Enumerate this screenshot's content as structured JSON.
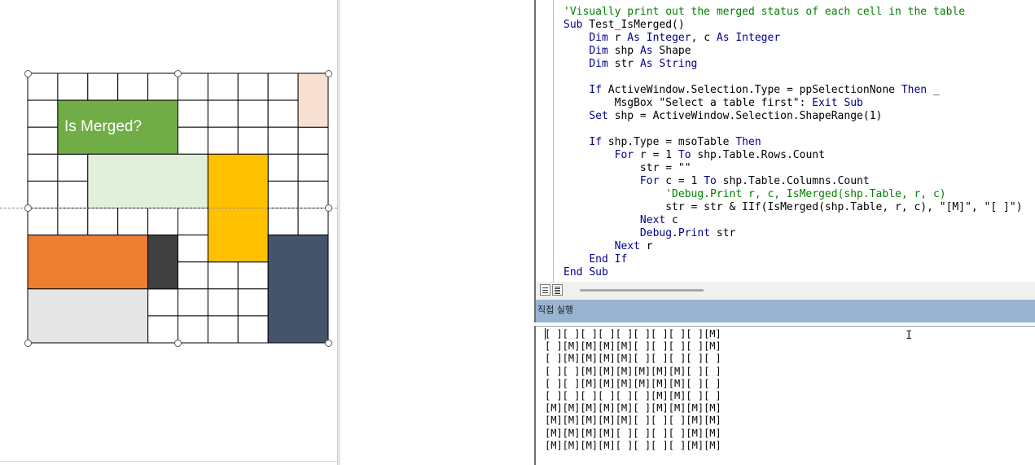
{
  "slide": {
    "table_label": "Is Merged?",
    "colors": {
      "green": "#70ad47",
      "light_green": "#e2efda",
      "peach": "#f8e0d2",
      "yellow": "#ffc000",
      "orange": "#ed7d31",
      "dark_gray": "#404040",
      "navy": "#44546a",
      "light_gray": "#e6e6e6"
    }
  },
  "code": {
    "lines": [
      "'Visually print out the merged status of each cell in the table",
      "Sub Test_IsMerged()",
      "    Dim r As Integer, c As Integer",
      "    Dim shp As Shape",
      "    Dim str As String",
      "",
      "    If ActiveWindow.Selection.Type = ppSelectionNone Then _",
      "        MsgBox \"Select a table first\": Exit Sub",
      "    Set shp = ActiveWindow.Selection.ShapeRange(1)",
      "",
      "    If shp.Type = msoTable Then",
      "        For r = 1 To shp.Table.Rows.Count",
      "            str = \"\"",
      "            For c = 1 To shp.Table.Columns.Count",
      "                'Debug.Print r, c, IsMerged(shp.Table, r, c)",
      "                str = str & IIf(IsMerged(shp.Table, r, c), \"[M]\", \"[ ]\")",
      "            Next c",
      "            Debug.Print str",
      "        Next r",
      "    End If",
      "End Sub"
    ]
  },
  "immediate": {
    "title": "직접 실행",
    "lines": [
      "[ ][ ][ ][ ][ ][ ][ ][ ][ ][M]",
      "[ ][M][M][M][M][ ][ ][ ][ ][M]",
      "[ ][M][M][M][M][ ][ ][ ][ ][ ]",
      "[ ][ ][M][M][M][M][M][M][ ][ ]",
      "[ ][ ][M][M][M][M][M][M][ ][ ]",
      "[ ][ ][ ][ ][ ][ ][M][M][ ][ ]",
      "[M][M][M][M][M][ ][M][M][M][M]",
      "[M][M][M][M][M][ ][ ][ ][M][M]",
      "[M][M][M][M][ ][ ][ ][ ][M][M]",
      "[M][M][M][M][ ][ ][ ][ ][M][M]"
    ]
  }
}
